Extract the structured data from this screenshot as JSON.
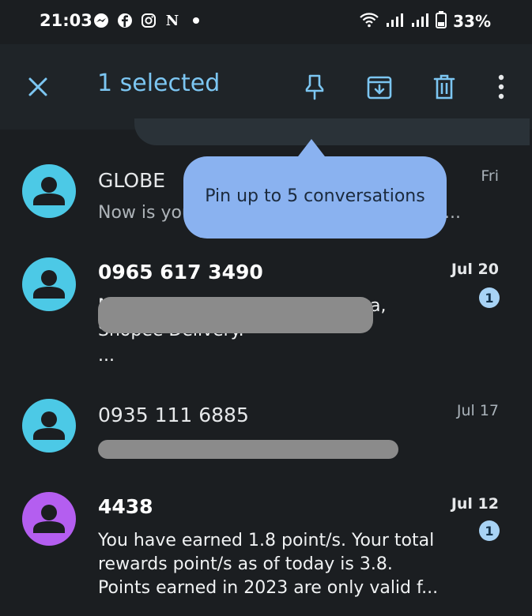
{
  "status_bar": {
    "time": "21:03",
    "left_icons": [
      "messenger-icon",
      "facebook-icon",
      "instagram-icon",
      "netflix-icon",
      "dot-icon"
    ],
    "netflix_glyph": "N",
    "battery": "33%"
  },
  "action_bar": {
    "title": "1 selected",
    "accent": "#7cc6f2"
  },
  "tooltip": {
    "text": "Pin up to 5 conversations",
    "color": "#8ab2f0"
  },
  "conversations": [
    {
      "name": "GLOBE",
      "date": "Fri",
      "snippet_lead": "Now is you",
      "snippet_tail": "...",
      "avatar_color": "#4cc9e6",
      "unread": false
    },
    {
      "name": "0965 617 3490",
      "date": "Jul 20",
      "badge": "1",
      "snippet_fragment_1": "M",
      "snippet_fragment_2": "a,",
      "snippet_line2": "Shopee Delivery.",
      "snippet_line3": "...",
      "avatar_color": "#4cc9e6",
      "unread": true
    },
    {
      "name": "0935 111 6885",
      "date": "Jul 17",
      "avatar_color": "#4cc9e6",
      "unread": false
    },
    {
      "name": "4438",
      "date": "Jul 12",
      "badge": "1",
      "snippet_lines": [
        "You have earned 1.8 point/s. Your total",
        "rewards point/s as of today is 3.8.",
        "Points earned in 2023 are only valid f..."
      ],
      "avatar_color": "#b45ef0",
      "unread": true
    }
  ]
}
